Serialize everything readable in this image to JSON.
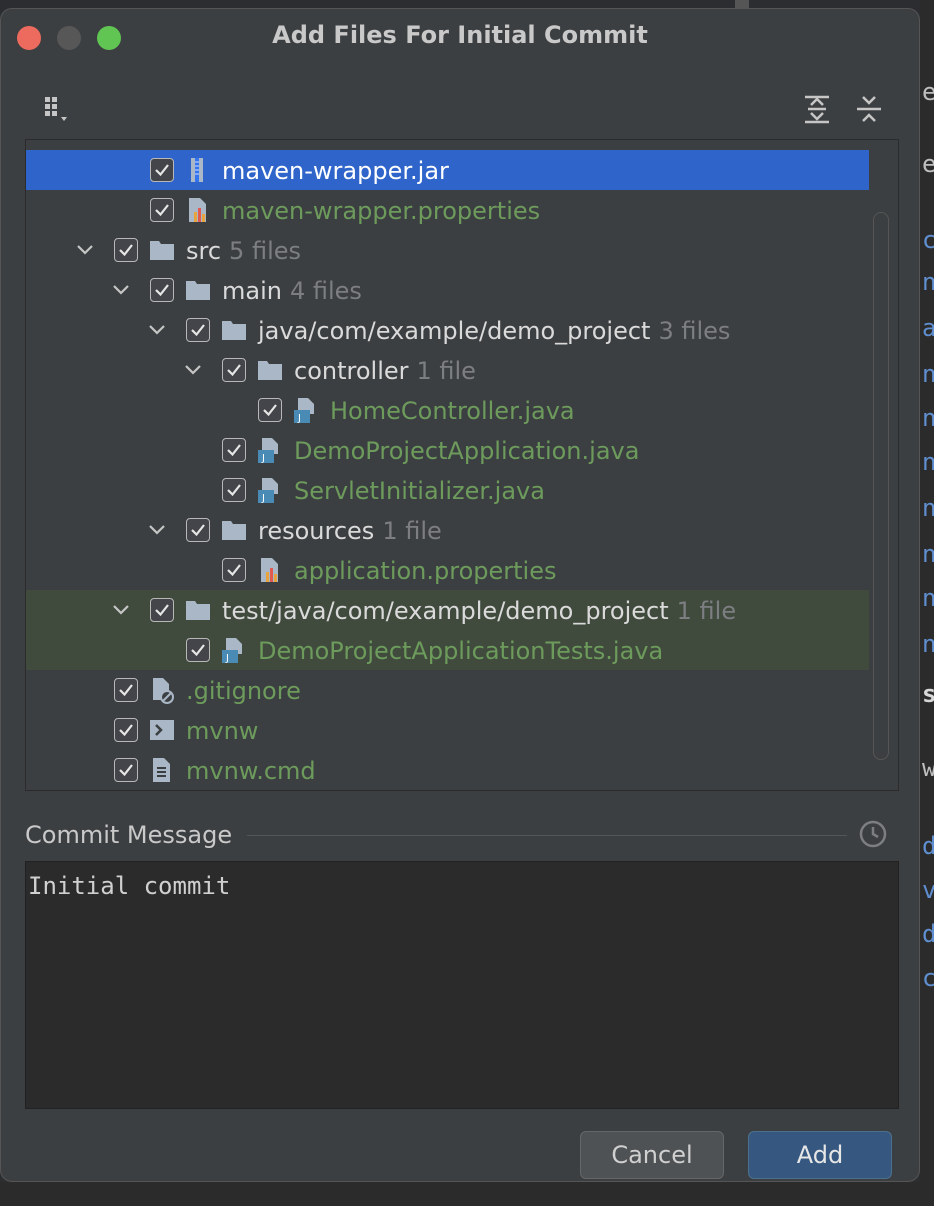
{
  "window": {
    "title": "Add Files For Initial Commit"
  },
  "toolbar": {
    "group_icon": "group-by-icon",
    "expand_icon": "expand-all-icon",
    "collapse_icon": "collapse-all-icon"
  },
  "tree": {
    "rows": [
      {
        "name": "maven-wrapper.jar",
        "count": "",
        "kind": "file",
        "icon": "jar-icon",
        "checked": true,
        "selected": true
      },
      {
        "name": "maven-wrapper.properties",
        "count": "",
        "kind": "file",
        "icon": "properties-icon",
        "checked": true
      },
      {
        "name": "src",
        "count": "5 files",
        "kind": "folder",
        "icon": "folder-icon",
        "checked": true,
        "expanded": true
      },
      {
        "name": "main",
        "count": "4 files",
        "kind": "folder",
        "icon": "folder-icon",
        "checked": true,
        "expanded": true
      },
      {
        "name": "java/com/example/demo_project",
        "count": "3 files",
        "kind": "folder",
        "icon": "folder-icon",
        "checked": true,
        "expanded": true
      },
      {
        "name": "controller",
        "count": "1 file",
        "kind": "folder",
        "icon": "folder-icon",
        "checked": true,
        "expanded": true
      },
      {
        "name": "HomeController.java",
        "count": "",
        "kind": "file",
        "icon": "java-file-icon",
        "checked": true
      },
      {
        "name": "DemoProjectApplication.java",
        "count": "",
        "kind": "file",
        "icon": "java-file-icon",
        "checked": true
      },
      {
        "name": "ServletInitializer.java",
        "count": "",
        "kind": "file",
        "icon": "java-file-icon",
        "checked": true
      },
      {
        "name": "resources",
        "count": "1 file",
        "kind": "folder",
        "icon": "folder-icon",
        "checked": true,
        "expanded": true
      },
      {
        "name": "application.properties",
        "count": "",
        "kind": "file",
        "icon": "properties-icon",
        "checked": true
      },
      {
        "name": "test/java/com/example/demo_project",
        "count": "1 file",
        "kind": "folder",
        "icon": "folder-icon",
        "checked": true,
        "expanded": true
      },
      {
        "name": "DemoProjectApplicationTests.java",
        "count": "",
        "kind": "file",
        "icon": "java-file-icon",
        "checked": true
      },
      {
        "name": ".gitignore",
        "count": "",
        "kind": "file",
        "icon": "gitignore-icon",
        "checked": true
      },
      {
        "name": "mvnw",
        "count": "",
        "kind": "file",
        "icon": "shell-script-icon",
        "checked": true
      },
      {
        "name": "mvnw.cmd",
        "count": "",
        "kind": "file",
        "icon": "text-file-icon",
        "checked": true
      }
    ]
  },
  "commit": {
    "label": "Commit Message",
    "message": "Initial commit",
    "history_icon": "history-icon"
  },
  "buttons": {
    "cancel": "Cancel",
    "add": "Add"
  },
  "colors": {
    "selection": "#2f65ca",
    "new_file_text": "#6d9b5c",
    "primary_button": "#365880"
  },
  "background": {
    "right_edge_glyphs": [
      "er",
      "e",
      "ci",
      "n",
      "a",
      "n",
      "n",
      "n",
      "n",
      "n",
      "n",
      "n",
      "s",
      "w",
      "d",
      "vi",
      "d",
      "c"
    ]
  }
}
